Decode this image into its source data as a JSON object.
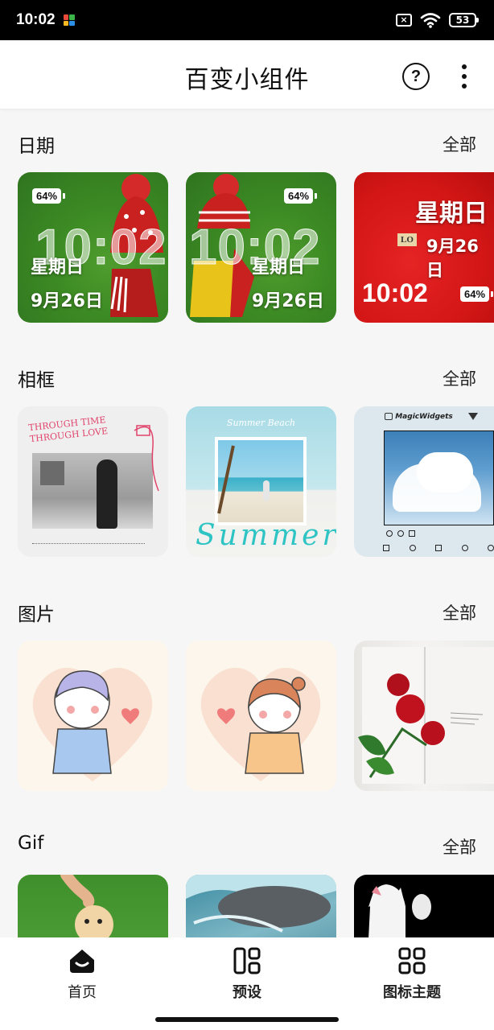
{
  "status_bar": {
    "time": "10:02",
    "battery": "53",
    "sim_icon": "sim-x-icon",
    "wifi_icon": "wifi-icon"
  },
  "header": {
    "title": "百变小组件",
    "help_icon": "help-circle-icon",
    "more_icon": "more-vertical-icon"
  },
  "sections": [
    {
      "title": "日期",
      "all_label": "全部",
      "cards": [
        {
          "battery": "64%",
          "time": "10:02",
          "weekday": "星期日",
          "date": "9月26日"
        },
        {
          "battery": "64%",
          "time": "10:02",
          "weekday": "星期日",
          "date": "9月26日"
        },
        {
          "battery": "64%",
          "time": "10:02",
          "weekday": "星期日",
          "date": "9月26日",
          "tiles": "LO"
        }
      ]
    },
    {
      "title": "相框",
      "all_label": "全部",
      "cards": [
        {
          "caption": "THROUGH TIME THROUGH LOVE"
        },
        {
          "caption_top": "Summer Beach",
          "caption_script": "Summer"
        },
        {
          "brand": "MagicWidgets"
        }
      ]
    },
    {
      "title": "图片",
      "all_label": "全部",
      "cards": [
        {
          "image": "cartoon-boy-heart"
        },
        {
          "image": "cartoon-girl-heart"
        },
        {
          "image": "roses-on-book"
        }
      ]
    },
    {
      "title": "Gif",
      "all_label": "全部",
      "cards": [
        {
          "image": "puppy-grass"
        },
        {
          "image": "seal-underwater"
        },
        {
          "image": "lucky-cat"
        }
      ]
    }
  ],
  "bottom_nav": {
    "items": [
      {
        "label": "首页",
        "icon": "home-icon",
        "active": true
      },
      {
        "label": "预设",
        "icon": "presets-icon",
        "active": false
      },
      {
        "label": "图标主题",
        "icon": "icon-theme-grid-icon",
        "active": false
      }
    ]
  },
  "colors": {
    "background": "#f6f6f6",
    "header_bg": "#ffffff",
    "text": "#111111"
  }
}
